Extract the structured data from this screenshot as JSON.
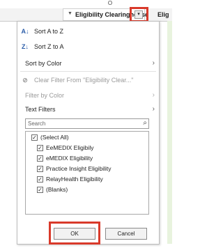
{
  "sheet": {
    "column_letter": "O",
    "column_header": "Eligibility Clearinghouse",
    "adjacent_header": "Elig"
  },
  "menu": {
    "items": [
      {
        "icon": "sort-a-z-icon",
        "label": "Sort A to Z",
        "disabled": false,
        "submenu": false
      },
      {
        "icon": "sort-z-a-icon",
        "label": "Sort Z to A",
        "disabled": false,
        "submenu": false
      },
      {
        "icon": "",
        "label": "Sort by Color",
        "disabled": false,
        "submenu": true
      },
      {
        "icon": "clear-filter-icon",
        "label": "Clear Filter From \"Eligibility Clear...\"",
        "disabled": true,
        "submenu": false
      },
      {
        "icon": "",
        "label": "Filter by Color",
        "disabled": true,
        "submenu": true
      },
      {
        "icon": "",
        "label": "Text Filters",
        "disabled": false,
        "submenu": true
      }
    ],
    "search": {
      "placeholder": "Search"
    },
    "filter_values": [
      {
        "label": "(Select All)",
        "checked": true
      },
      {
        "label": "EeMEDIX Eligibily",
        "checked": true
      },
      {
        "label": "eMEDIX Eligibility",
        "checked": true
      },
      {
        "label": "Practice Insight Eligibility",
        "checked": true
      },
      {
        "label": "RelayHealth Eligibility",
        "checked": true
      },
      {
        "label": "(Blanks)",
        "checked": true
      }
    ],
    "ok_label": "OK",
    "cancel_label": "Cancel"
  },
  "colors": {
    "highlight": "#d93a2b",
    "icon_blue": "#2a5ca8"
  }
}
